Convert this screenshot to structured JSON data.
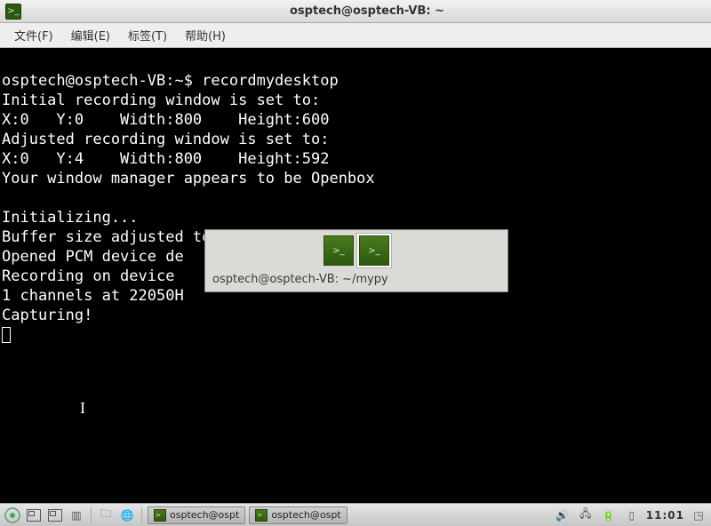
{
  "window": {
    "title": "osptech@osptech-VB: ~"
  },
  "menu": {
    "file": "文件(F)",
    "edit": "编辑(E)",
    "tabs": "标签(T)",
    "help": "帮助(H)"
  },
  "terminal": {
    "prompt": "osptech@osptech-VB:~$ ",
    "command": "recordmydesktop",
    "lines": [
      "Initial recording window is set to:",
      "X:0   Y:0    Width:800    Height:600",
      "Adjusted recording window is set to:",
      "X:0   Y:4    Width:800    Height:592",
      "Your window manager appears to be Openbox",
      "",
      "Initializing...",
      "Buffer size adjusted to 4096 from 4096 frames.",
      "Opened PCM device de",
      "Recording on device ",
      "1 channels at 22050H",
      "Capturing!"
    ]
  },
  "switcher": {
    "label": "osptech@osptech-VB: ~/mypy"
  },
  "taskbar": {
    "task1": "osptech@ospt",
    "task2": "osptech@ospt",
    "clock": "11:01"
  }
}
